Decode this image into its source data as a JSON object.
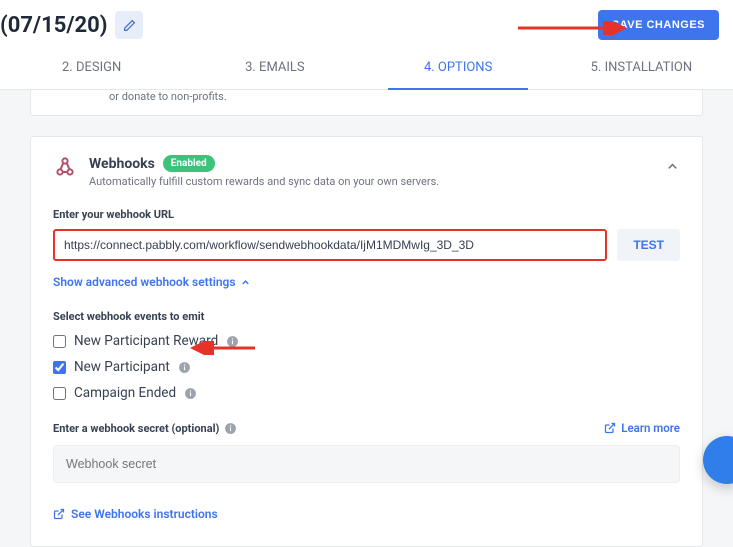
{
  "header": {
    "title": "(07/15/20)",
    "save_label": "SAVE CHANGES"
  },
  "tabs": {
    "design": "2. DESIGN",
    "emails": "3. EMAILS",
    "options": "4. OPTIONS",
    "installation": "5. INSTALLATION"
  },
  "fragment": "or donate to non-profits.",
  "webhooks": {
    "title": "Webhooks",
    "badge": "Enabled",
    "sub": "Automatically fulfill custom rewards and sync data on your own servers.",
    "url_label": "Enter your webhook URL",
    "url_value": "https://connect.pabbly.com/workflow/sendwebhookdata/IjM1MDMwIg_3D_3D",
    "test_label": "TEST",
    "advanced_toggle": "Show advanced webhook settings",
    "events_label": "Select webhook events to emit",
    "events": {
      "reward": "New Participant Reward",
      "participant": "New Participant",
      "ended": "Campaign Ended"
    },
    "secret_label": "Enter a webhook secret (optional)",
    "secret_placeholder": "Webhook secret",
    "learn_more": "Learn more",
    "instructions": "See Webhooks instructions"
  }
}
